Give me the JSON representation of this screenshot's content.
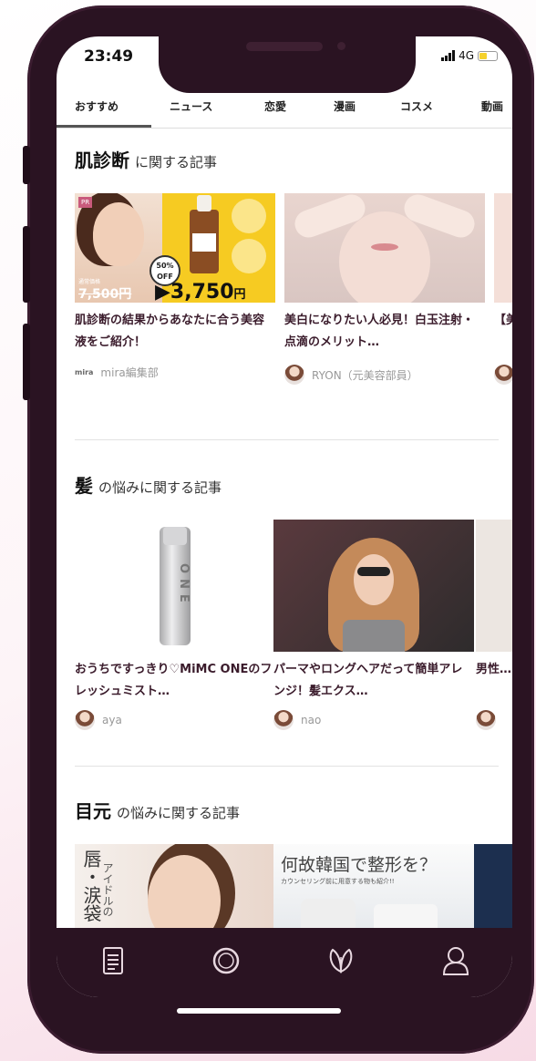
{
  "status": {
    "time": "23:49",
    "network": "4G"
  },
  "tabs": [
    {
      "label": "おすすめ"
    },
    {
      "label": "ニュース"
    },
    {
      "label": "恋愛"
    },
    {
      "label": "漫画"
    },
    {
      "label": "コスメ"
    },
    {
      "label": "動画"
    }
  ],
  "sections": [
    {
      "keyword": "肌診断",
      "suffix": "に関する記事",
      "cards": [
        {
          "title": "肌診断の結果からあなたに合う美容液をご紹介！",
          "author": "mira編集部",
          "logo": "mira",
          "ad": {
            "badge": "PR",
            "regular_label": "通常価格",
            "regular_price": "7,500円",
            "discount": "50% OFF",
            "price": "▶3,750",
            "unit": "円"
          }
        },
        {
          "title": "美白になりたい人必見！白玉注射・点滴のメリット…",
          "author": "RYON（元美容部員）"
        },
        {
          "title": "【美…レー…",
          "author": ""
        }
      ]
    },
    {
      "keyword": "髪",
      "suffix": "の悩みに関する記事",
      "cards": [
        {
          "title": "おうちですっきり♡MiMC ONEのフレッシュミスト…",
          "author": "aya",
          "product_label": "ONE"
        },
        {
          "title": "パーマやロングヘアだって簡単アレンジ！髪エクス…",
          "author": "nao"
        },
        {
          "title": "男性…",
          "author": ""
        }
      ]
    },
    {
      "keyword": "目元",
      "suffix": "の悩みに関する記事",
      "cards": [
        {
          "overlay_text": "唇・涙袋",
          "overlay_sub": "アイドルの"
        },
        {
          "overlay_text": "何故韓国で整形を？",
          "overlay_sub": "カウンセリング前に用意する物も紹介!!"
        }
      ]
    }
  ],
  "bottom_nav": [
    {
      "icon": "article-icon"
    },
    {
      "icon": "circle-icon"
    },
    {
      "icon": "leaf-icon"
    },
    {
      "icon": "user-icon"
    }
  ],
  "colors": {
    "frame": "#2a1322",
    "accent_yellow": "#f6cb22",
    "title_text": "#3b1c2c"
  }
}
